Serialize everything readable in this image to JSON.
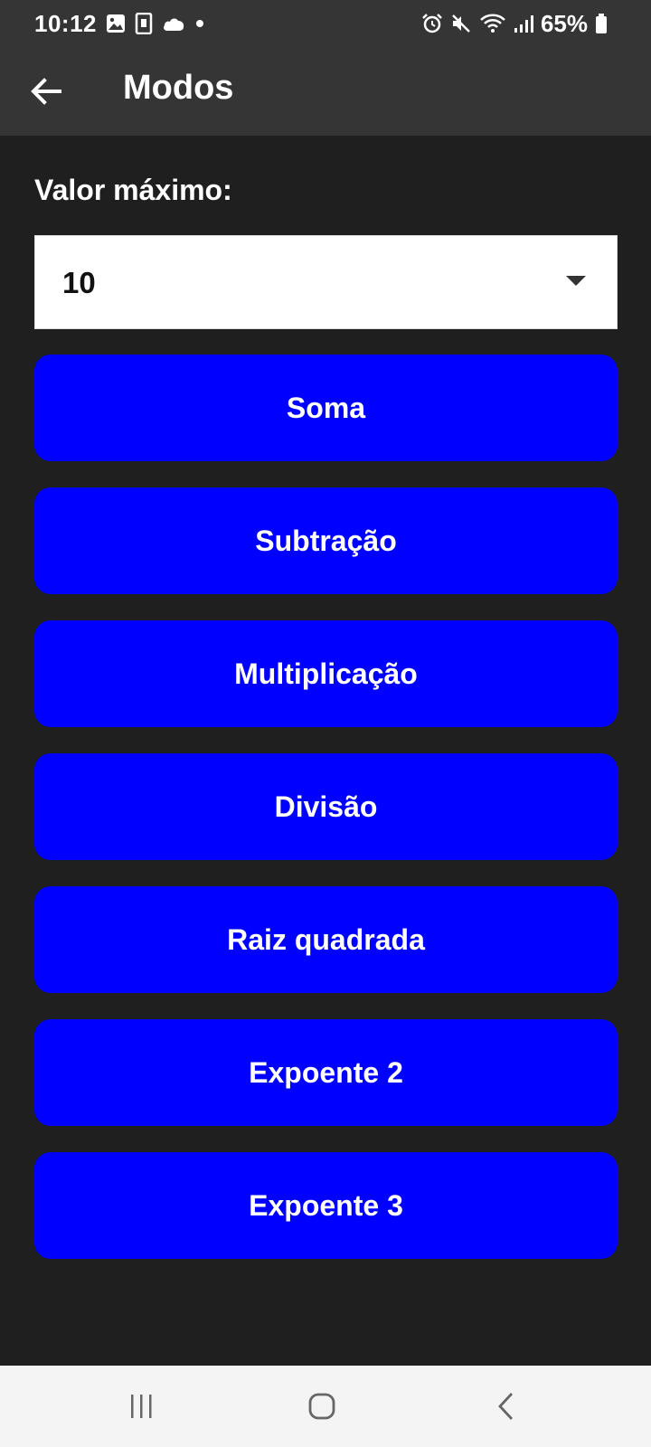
{
  "status_bar": {
    "time": "10:12",
    "battery_text": "65%",
    "left_icons": [
      "gallery-icon",
      "app-notification-icon",
      "cloud-icon",
      "dot-icon"
    ],
    "right_icons": [
      "alarm-icon",
      "mute-icon",
      "wifi-icon",
      "signal-icon",
      "battery-icon"
    ]
  },
  "app_bar": {
    "title": "Modos",
    "back_icon": "arrow-left-icon"
  },
  "settings": {
    "max_label": "Valor máximo:",
    "max_value": "10"
  },
  "modes": [
    {
      "label": "Soma"
    },
    {
      "label": "Subtração"
    },
    {
      "label": "Multiplicação"
    },
    {
      "label": "Divisão"
    },
    {
      "label": "Raiz quadrada"
    },
    {
      "label": "Expoente 2"
    },
    {
      "label": "Expoente 3"
    }
  ],
  "colors": {
    "mode_button_bg": "#0000ff",
    "background": "#1f1f1f",
    "app_bar_bg": "#353535",
    "nav_bar_bg": "#f4f4f4"
  },
  "nav_bar": {
    "icons": [
      "recents-icon",
      "home-icon",
      "back-icon"
    ]
  }
}
